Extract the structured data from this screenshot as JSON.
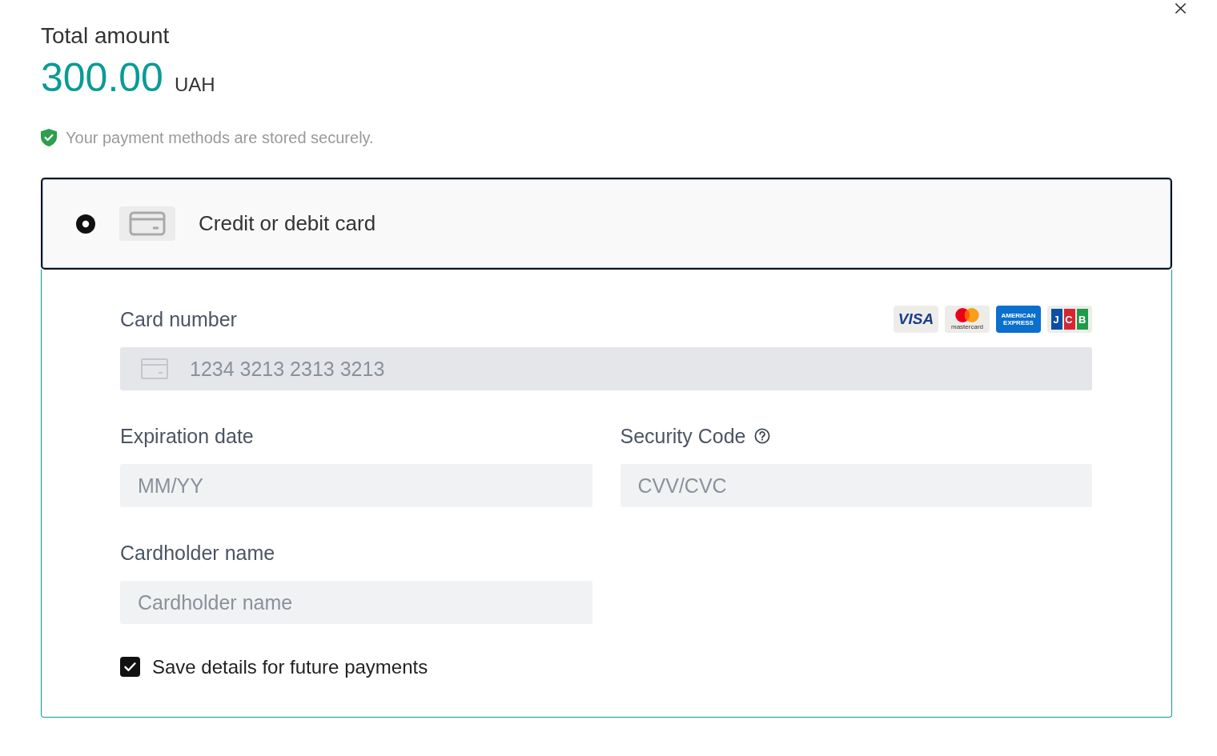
{
  "summary": {
    "title": "Total amount",
    "amount": "300.00",
    "currency": "UAH"
  },
  "security_note": "Your payment methods are stored securely.",
  "payment_methods": [
    {
      "label": "Credit or debit card",
      "selected": true,
      "expanded": true,
      "form": {
        "card_number": {
          "label": "Card number",
          "placeholder": "1234 3213 2313 3213"
        },
        "brands": [
          {
            "kind": "visa",
            "label": "VISA"
          },
          {
            "kind": "mastercard",
            "label": "mastercard"
          },
          {
            "kind": "amex",
            "label": "AMERICAN EXPRESS"
          },
          {
            "kind": "jcb",
            "label": "JCB"
          }
        ],
        "expiration_date": {
          "label": "Expiration date",
          "placeholder": "MM/YY"
        },
        "security_code": {
          "label": "Security Code",
          "placeholder": "CVV/CVC"
        },
        "cardholder_name": {
          "label": "Cardholder name",
          "placeholder": "Cardholder name"
        },
        "save_details": {
          "label": "Save details for future payments",
          "checked": true
        }
      }
    }
  ]
}
